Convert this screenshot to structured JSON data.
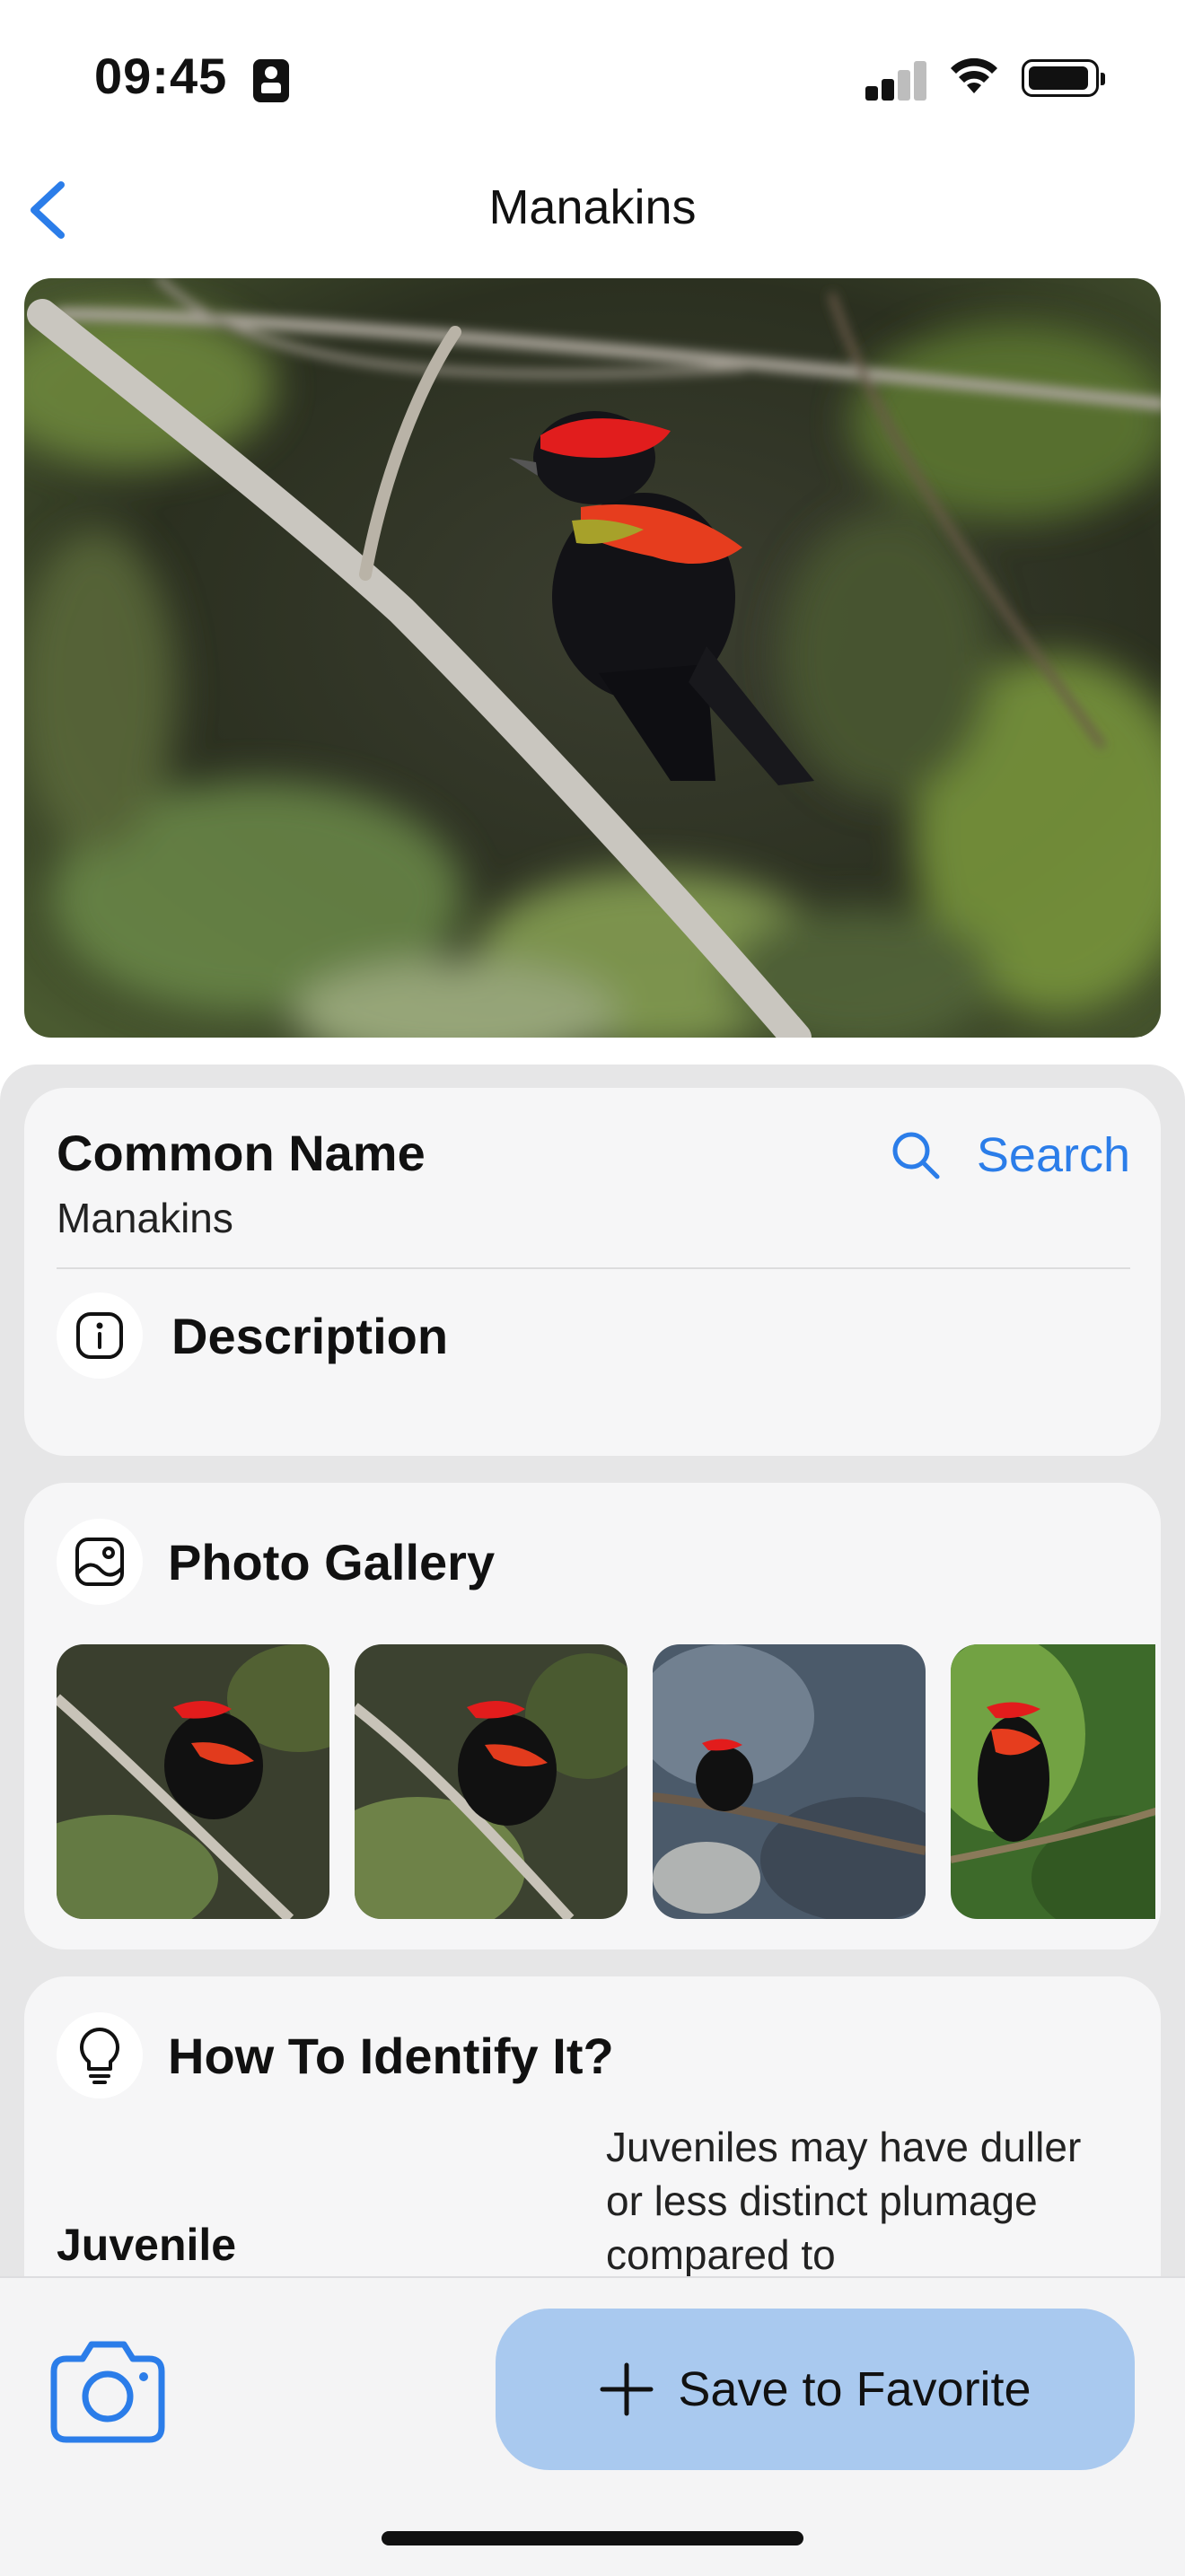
{
  "status_bar": {
    "time": "09:45"
  },
  "nav": {
    "title": "Manakins",
    "back_icon": "chevron-left-icon"
  },
  "colors": {
    "accent": "#2b7de9",
    "save_button_bg": "#a9c9ef",
    "sheet_bg": "#e6e6e7",
    "card_bg": "#f6f6f7"
  },
  "common_name": {
    "label": "Common Name",
    "value": "Manakins",
    "search_label": "Search",
    "search_icon": "magnifier-icon"
  },
  "description": {
    "title": "Description",
    "icon": "info-icon"
  },
  "gallery": {
    "title": "Photo Gallery",
    "icon": "photo-icon",
    "thumbnail_count_visible": 4
  },
  "identify": {
    "title": "How To Identify It?",
    "icon": "lightbulb-icon",
    "rows": [
      {
        "label": "Juvenile",
        "text": "Juveniles may have duller or less distinct plumage compared to"
      }
    ]
  },
  "bottom_bar": {
    "camera_icon": "camera-icon",
    "save_label": "Save to Favorite",
    "save_icon": "plus-icon"
  }
}
